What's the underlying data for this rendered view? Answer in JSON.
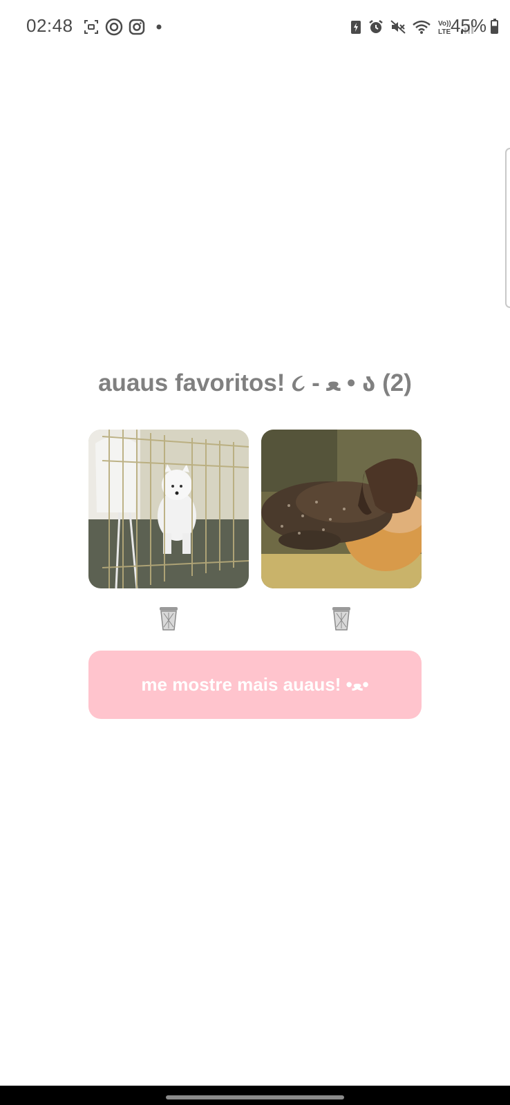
{
  "status_bar": {
    "time": "02:48",
    "battery_percent": "45%",
    "battery_level": 0.45,
    "left_icons": [
      "screen-recorder-icon",
      "threads-icon",
      "instagram-icon",
      "notification-dot-icon"
    ],
    "right_icons": [
      "battery-saver-icon",
      "alarm-icon",
      "mute-icon",
      "wifi-icon",
      "volte-icon",
      "signal-icon"
    ],
    "volte_label": "Vo)) LTE"
  },
  "favorites": {
    "title": "auaus favoritos! ૮ - ﻌ • ა (2)",
    "items": [
      {
        "image": "white samoyed puppy sitting inside a wire crate",
        "delete_icon": "trash-icon"
      },
      {
        "image": "brown dog sleeping on a cushion",
        "delete_icon": "trash-icon"
      }
    ]
  },
  "actions": {
    "more_label": "me mostre mais auaus! •ﻌ•"
  },
  "colors": {
    "title": "#808080",
    "button_bg": "#ffc4cd",
    "button_text": "#ffffff",
    "status_text": "#4a4a4a"
  }
}
